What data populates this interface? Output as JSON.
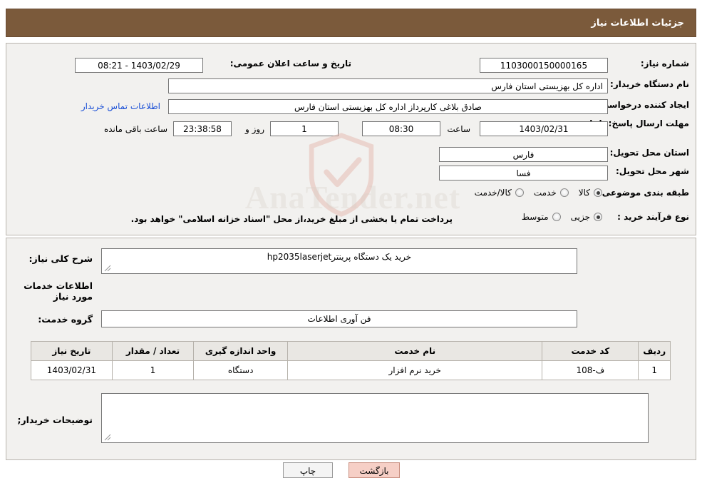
{
  "header": {
    "title": "جزئیات اطلاعات نیاز"
  },
  "watermark": {
    "text": "AnaTender.net",
    "shield_icon": "shield-icon"
  },
  "top_form": {
    "need_number_label": "شماره نیاز:",
    "need_number_value": "1103000150000165",
    "announce_datetime_label": "تاریخ و ساعت اعلان عمومی:",
    "announce_datetime_value": "1403/02/29 - 08:21",
    "buyer_org_label": "نام دستگاه خریدار:",
    "buyer_org_value": "اداره کل بهزیستی استان فارس",
    "requester_label": "ایجاد کننده درخواست:",
    "requester_value": "صادق  بلاغی کارپرداز اداره کل بهزیستی استان فارس",
    "contact_link": "اطلاعات تماس خریدار",
    "deadline_label": "مهلت ارسال پاسخ: تا تاریخ:",
    "deadline_date": "1403/02/31",
    "time_label": "ساعت",
    "deadline_time": "08:30",
    "days_value": "1",
    "days_suffix": "روز و",
    "countdown_value": "23:38:58",
    "countdown_suffix": "ساعت باقی مانده",
    "province_label": "استان محل تحویل:",
    "province_value": "فارس",
    "city_label": "شهر محل تحویل:",
    "city_value": "فسا",
    "category_label": "طبقه بندی موضوعی:",
    "category_options": [
      {
        "label": "کالا",
        "selected": true
      },
      {
        "label": "خدمت",
        "selected": false
      },
      {
        "label": "کالا/خدمت",
        "selected": false
      }
    ],
    "purchase_type_label": "نوع فرآیند خرید :",
    "purchase_type_options": [
      {
        "label": "جزیی",
        "selected": true
      },
      {
        "label": "متوسط",
        "selected": false
      }
    ],
    "purchase_note": "پرداخت تمام یا بخشی از مبلغ خرید،از محل \"اسناد خزانه اسلامی\" خواهد بود."
  },
  "bottom": {
    "summary_label": "شرح کلی نیاز:",
    "summary_value": "خرید یک دستگاه پرینترhp2035laserjet",
    "services_section_title": "اطلاعات خدمات مورد نیاز",
    "service_group_label": "گروه خدمت:",
    "service_group_value": "فن آوری اطلاعات",
    "buyer_notes_label": "توضیحات خریدار;",
    "buyer_notes_value": ""
  },
  "table": {
    "headers": [
      "ردیف",
      "کد خدمت",
      "نام خدمت",
      "واحد اندازه گیری",
      "تعداد / مقدار",
      "تاریخ نیاز"
    ],
    "rows": [
      {
        "index": "1",
        "code": "ف-108",
        "name": "خرید نرم افزار",
        "unit": "دستگاه",
        "qty": "1",
        "date": "1403/02/31"
      }
    ]
  },
  "footer": {
    "print_label": "چاپ",
    "back_label": "بازگشت"
  },
  "colors": {
    "header_bg": "#7b5a3b",
    "panel_bg": "#f2f1ef",
    "link": "#1a4fd6",
    "back_btn": "#f6cfc6"
  }
}
